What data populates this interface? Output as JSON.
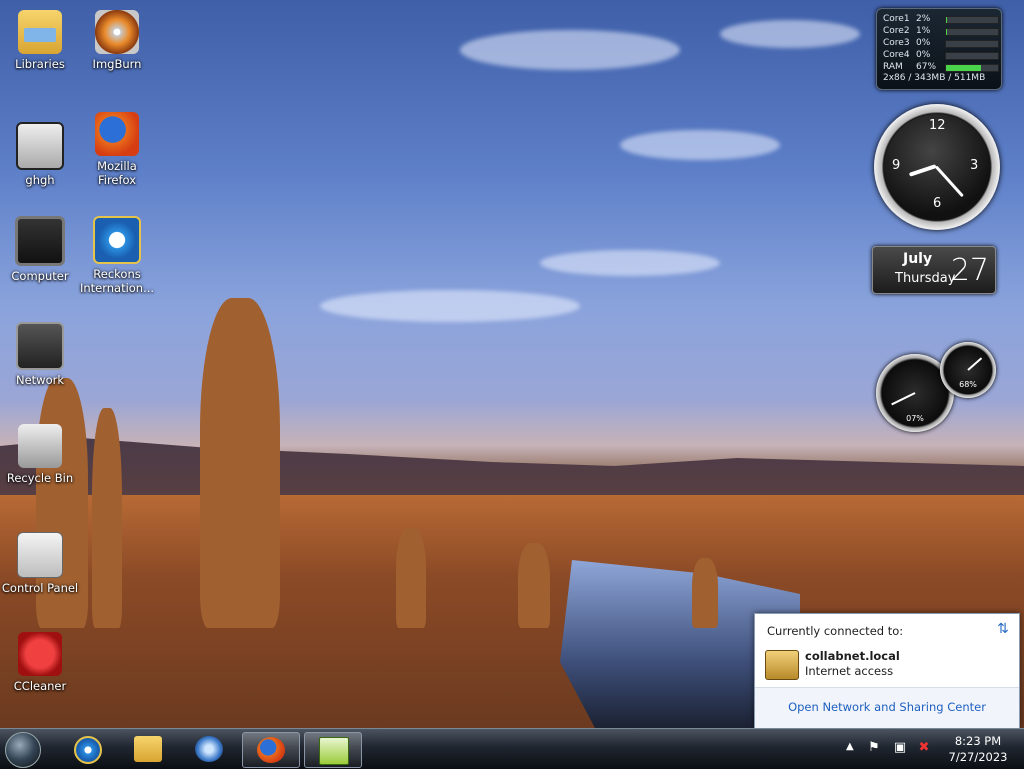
{
  "desktop": {
    "icons": [
      {
        "id": "libraries",
        "label": "Libraries",
        "icon": "libraries-folder-icon"
      },
      {
        "id": "imgburn",
        "label": "ImgBurn",
        "icon": "imgburn-disc-icon"
      },
      {
        "id": "ghgh",
        "label": "ghgh",
        "icon": "document-icon"
      },
      {
        "id": "firefox",
        "label": "Mozilla Firefox",
        "icon": "firefox-icon"
      },
      {
        "id": "computer",
        "label": "Computer",
        "icon": "computer-icon"
      },
      {
        "id": "reckons",
        "label": "Reckons Internation...",
        "icon": "internet-explorer-icon"
      },
      {
        "id": "network",
        "label": "Network",
        "icon": "network-icon"
      },
      {
        "id": "recycle",
        "label": "Recycle Bin",
        "icon": "recycle-bin-icon"
      },
      {
        "id": "control",
        "label": "Control Panel",
        "icon": "control-panel-icon"
      },
      {
        "id": "ccleaner",
        "label": "CCleaner",
        "icon": "ccleaner-icon"
      }
    ]
  },
  "cpu_gadget": {
    "rows": [
      {
        "label": "Core1",
        "value": "2%",
        "fill": 0.02
      },
      {
        "label": "Core2",
        "value": "1%",
        "fill": 0.01
      },
      {
        "label": "Core3",
        "value": "0%",
        "fill": 0.0
      },
      {
        "label": "Core4",
        "value": "0%",
        "fill": 0.0
      },
      {
        "label": "RAM",
        "value": "67%",
        "fill": 0.67
      }
    ],
    "footer": "2x86 / 343MB / 511MB"
  },
  "clock": {
    "numbers": [
      "12",
      "3",
      "6",
      "9"
    ],
    "hour": 8,
    "minute": 23
  },
  "calendar": {
    "month": "July",
    "weekday": "Thursday",
    "day": "27"
  },
  "meters": {
    "cpu_pct": "07%",
    "cpu_value": 7,
    "mem_pct": "68%",
    "mem_value": 68
  },
  "network_popup": {
    "header": "Currently connected to:",
    "network_name": "collabnet.local",
    "network_status": "Internet access",
    "link": "Open Network and Sharing Center"
  },
  "taskbar": {
    "buttons": [
      {
        "id": "ie",
        "icon": "internet-explorer-icon",
        "active": false
      },
      {
        "id": "explorer",
        "icon": "folder-icon",
        "active": false
      },
      {
        "id": "wmp",
        "icon": "media-player-icon",
        "active": false
      },
      {
        "id": "firefox",
        "icon": "firefox-icon",
        "active": true
      },
      {
        "id": "notepad",
        "icon": "notepad-plus-icon",
        "active": true
      }
    ],
    "tray": {
      "time": "8:23 PM",
      "date": "7/27/2023"
    }
  },
  "colors": {
    "link": "#1f5fbf",
    "ram_bar": "#49d44b",
    "taskbar_dark": "#0b0f14"
  }
}
